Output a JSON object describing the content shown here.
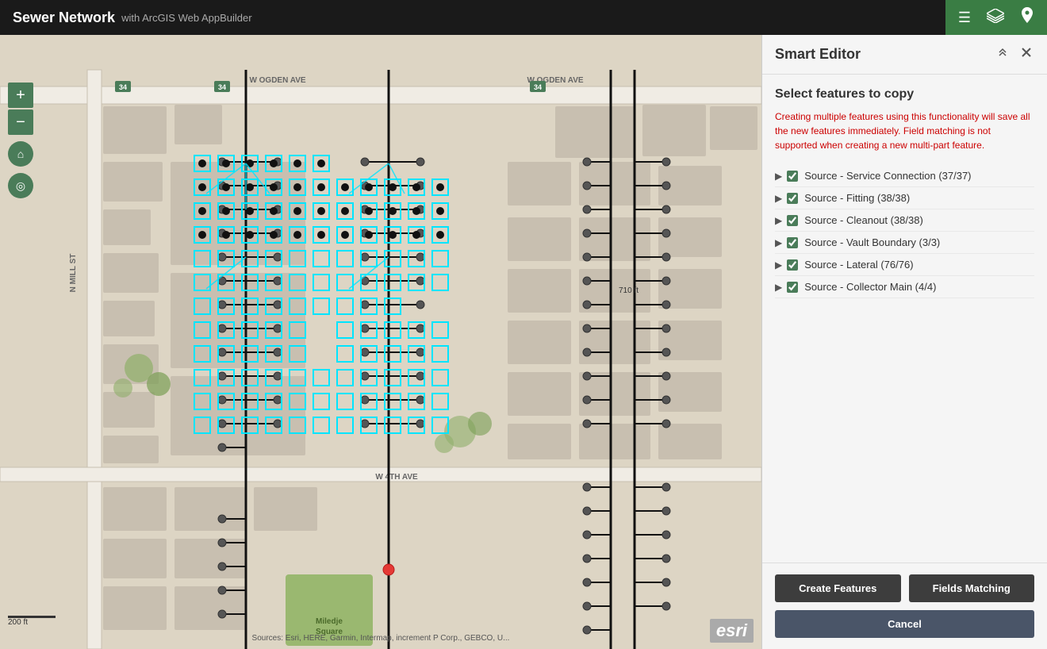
{
  "header": {
    "app_title": "Sewer Network",
    "app_subtitle": "with ArcGIS Web AppBuilder",
    "icons": [
      "list-icon",
      "layers-icon",
      "location-icon"
    ]
  },
  "map_controls": {
    "zoom_in": "+",
    "zoom_out": "−",
    "home": "⌂",
    "locate": "◎"
  },
  "map": {
    "attribution": "Sources: Esri, HERE, Garmin, Intermap, increment P Corp., GEBCO, U...",
    "esri_label": "esri",
    "scale_label": "200 ft",
    "distance_label": "710 ft"
  },
  "panel": {
    "title": "Smart Editor",
    "select_title": "Select features to copy",
    "warning": "Creating multiple features using this functionality will save all the new features immediately. Field matching is not supported when creating a new multi-part feature.",
    "features": [
      {
        "label": "Source - Service Connection (37/37)",
        "checked": true
      },
      {
        "label": "Source - Fitting (38/38)",
        "checked": true
      },
      {
        "label": "Source - Cleanout (38/38)",
        "checked": true
      },
      {
        "label": "Source - Vault Boundary (3/3)",
        "checked": true
      },
      {
        "label": "Source - Lateral (76/76)",
        "checked": true
      },
      {
        "label": "Source - Collector Main (4/4)",
        "checked": true
      }
    ],
    "buttons": {
      "create_features": "Create Features",
      "fields_matching": "Fields Matching",
      "cancel": "Cancel"
    }
  }
}
